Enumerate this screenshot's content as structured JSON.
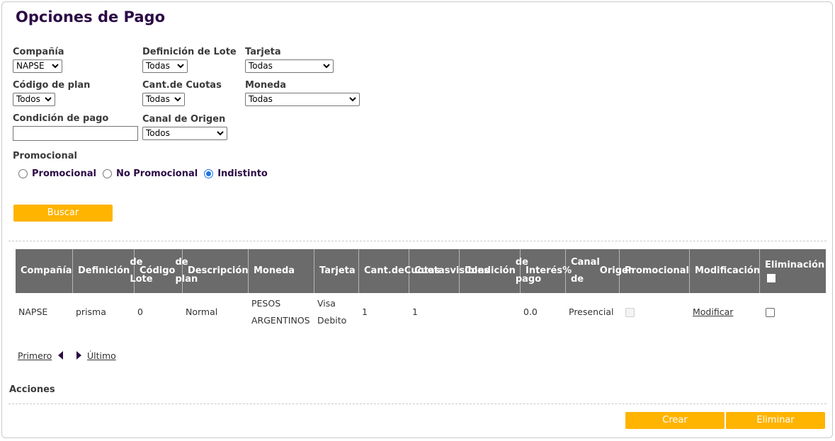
{
  "page": {
    "title": "Opciones de Pago"
  },
  "filters": {
    "compania": {
      "label": "Compañía",
      "value": "NAPSE"
    },
    "definicion_lote": {
      "label": "Definición de Lote",
      "value": "Todas"
    },
    "tarjeta": {
      "label": "Tarjeta",
      "value": "Todas"
    },
    "codigo_plan": {
      "label": "Código de plan",
      "value": "Todos"
    },
    "cant_cuotas": {
      "label": "Cant.de Cuotas",
      "value": "Todas"
    },
    "moneda": {
      "label": "Moneda",
      "value": "Todas"
    },
    "condicion_pago": {
      "label": "Condición de pago",
      "value": ""
    },
    "canal_origen": {
      "label": "Canal de Origen",
      "value": "Todos"
    },
    "promocional": {
      "label": "Promocional",
      "options": [
        "Promocional",
        "No Promocional",
        "Indistinto"
      ],
      "selected": "Indistinto"
    },
    "buscar_label": "Buscar"
  },
  "table": {
    "headers": {
      "compania": "Compañía",
      "definicion_lote_1": "Definición",
      "definicion_lote_2": "de Lote",
      "codigo_plan_1": "Código",
      "codigo_plan_2": "de plan",
      "descripcion": "Descripción",
      "moneda": "Moneda",
      "tarjeta": "Tarjeta",
      "cant_cuotas_1": "Cant.de",
      "cant_cuotas_2": "Cuotas",
      "cuotas_visibles_1": "Cuotas",
      "cuotas_visibles_2": "visibles",
      "condicion_pago_1": "Condición",
      "condicion_pago_2": "de pago",
      "interes_1": "Interés",
      "interes_2": "%",
      "canal_origen_1": "Canal de",
      "canal_origen_2": "Origen",
      "promocional": "Promocional",
      "modificacion": "Modificación",
      "eliminacion": "Eliminación"
    },
    "rows": [
      {
        "compania": "NAPSE",
        "definicion_lote": "prisma",
        "codigo_plan": "0",
        "descripcion": "Normal",
        "moneda_1": "PESOS",
        "moneda_2": "ARGENTINOS",
        "tarjeta_1": "Visa",
        "tarjeta_2": "Debito",
        "cant_cuotas": "1",
        "cuotas_visibles": "1",
        "condicion_pago": "",
        "interes": "0.0",
        "canal_origen": "Presencial",
        "promocional": false,
        "modificar_label": "Modificar",
        "eliminar_checked": false
      }
    ]
  },
  "pagination": {
    "first_label": "Primero",
    "last_label": "Último"
  },
  "acciones": {
    "title": "Acciones",
    "crear_label": "Crear",
    "eliminar_label": "Eliminar"
  },
  "colors": {
    "accent": "#ffb400",
    "header_bg": "#6b6b6b",
    "title": "#2b0b45"
  }
}
